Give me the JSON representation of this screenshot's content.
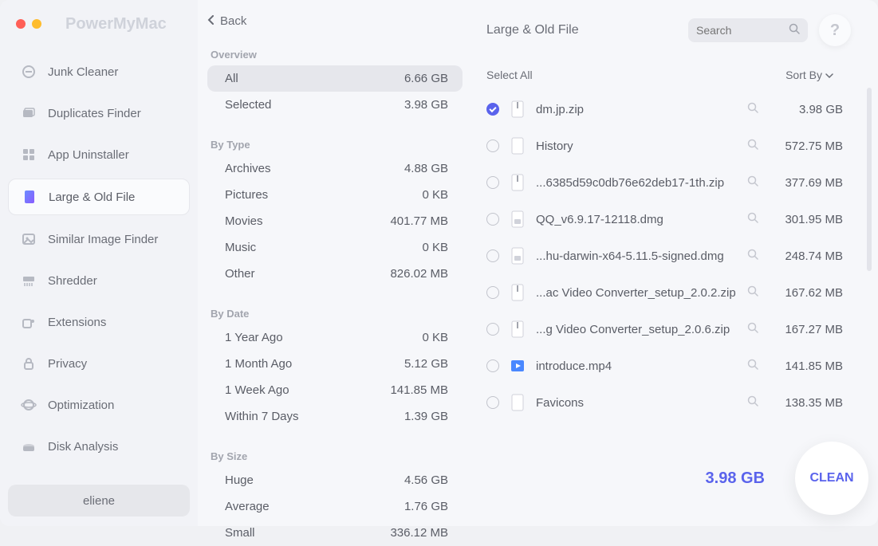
{
  "app": {
    "title": "PowerMyMac"
  },
  "back_label": "Back",
  "user": "eliene",
  "sidebar": {
    "items": [
      {
        "label": "Junk Cleaner",
        "icon": "broom-icon"
      },
      {
        "label": "Duplicates Finder",
        "icon": "folders-icon"
      },
      {
        "label": "App Uninstaller",
        "icon": "grid-icon"
      },
      {
        "label": "Large & Old File",
        "icon": "file-color-icon"
      },
      {
        "label": "Similar Image Finder",
        "icon": "image-icon"
      },
      {
        "label": "Shredder",
        "icon": "shredder-icon"
      },
      {
        "label": "Extensions",
        "icon": "puzzle-icon"
      },
      {
        "label": "Privacy",
        "icon": "lock-icon"
      },
      {
        "label": "Optimization",
        "icon": "planet-icon"
      },
      {
        "label": "Disk Analysis",
        "icon": "disk-icon"
      }
    ],
    "active_index": 3
  },
  "overview": {
    "title": "Overview",
    "rows": [
      {
        "label": "All",
        "value": "6.66 GB"
      },
      {
        "label": "Selected",
        "value": "3.98 GB"
      }
    ],
    "active_index": 0
  },
  "by_type": {
    "title": "By Type",
    "rows": [
      {
        "label": "Archives",
        "value": "4.88 GB"
      },
      {
        "label": "Pictures",
        "value": "0 KB"
      },
      {
        "label": "Movies",
        "value": "401.77 MB"
      },
      {
        "label": "Music",
        "value": "0 KB"
      },
      {
        "label": "Other",
        "value": "826.02 MB"
      }
    ]
  },
  "by_date": {
    "title": "By Date",
    "rows": [
      {
        "label": "1 Year Ago",
        "value": "0 KB"
      },
      {
        "label": "1 Month Ago",
        "value": "5.12 GB"
      },
      {
        "label": "1 Week Ago",
        "value": "141.85 MB"
      },
      {
        "label": "Within 7 Days",
        "value": "1.39 GB"
      }
    ]
  },
  "by_size": {
    "title": "By Size",
    "rows": [
      {
        "label": "Huge",
        "value": "4.56 GB"
      },
      {
        "label": "Average",
        "value": "1.76 GB"
      },
      {
        "label": "Small",
        "value": "336.12 MB"
      }
    ]
  },
  "main": {
    "title": "Large & Old File",
    "search_placeholder": "Search",
    "select_all_label": "Select All",
    "sort_by_label": "Sort By",
    "selected_total": "3.98 GB",
    "clean_label": "CLEAN"
  },
  "files": [
    {
      "name": "dm.jp.zip",
      "size": "3.98 GB",
      "icon": "zip",
      "checked": true
    },
    {
      "name": "History",
      "size": "572.75 MB",
      "icon": "doc",
      "checked": false
    },
    {
      "name": "...6385d59c0db76e62deb17-1th.zip",
      "size": "377.69 MB",
      "icon": "zip",
      "checked": false
    },
    {
      "name": "QQ_v6.9.17-12118.dmg",
      "size": "301.95 MB",
      "icon": "dmg",
      "checked": false
    },
    {
      "name": "...hu-darwin-x64-5.11.5-signed.dmg",
      "size": "248.74 MB",
      "icon": "dmg",
      "checked": false
    },
    {
      "name": "...ac Video Converter_setup_2.0.2.zip",
      "size": "167.62 MB",
      "icon": "zip",
      "checked": false
    },
    {
      "name": "...g Video Converter_setup_2.0.6.zip",
      "size": "167.27 MB",
      "icon": "zip",
      "checked": false
    },
    {
      "name": "introduce.mp4",
      "size": "141.85 MB",
      "icon": "mp4",
      "checked": false
    },
    {
      "name": "Favicons",
      "size": "138.35 MB",
      "icon": "doc",
      "checked": false
    }
  ]
}
